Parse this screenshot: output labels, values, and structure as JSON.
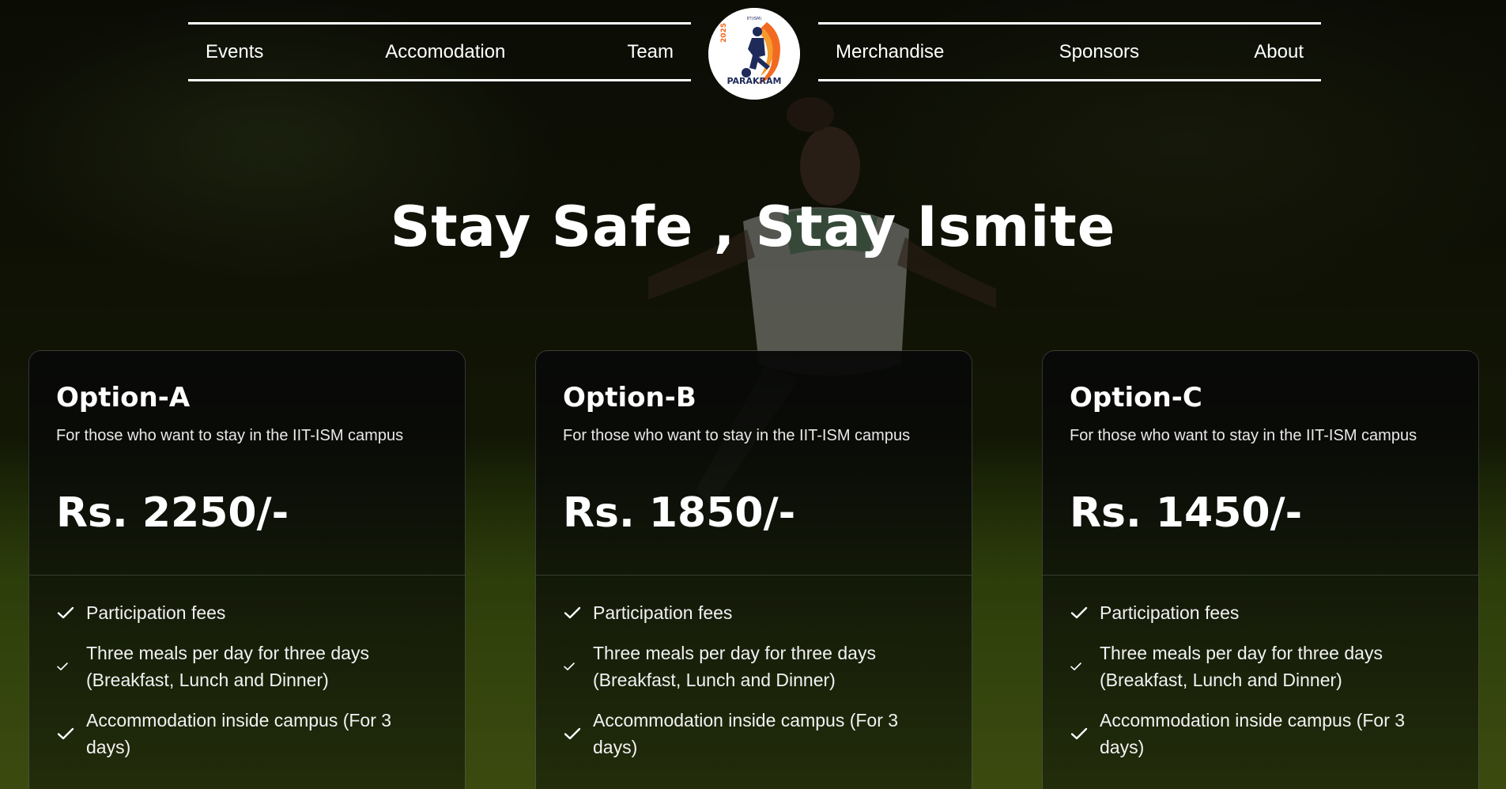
{
  "nav": {
    "left": [
      "Events",
      "Accomodation",
      "Team"
    ],
    "right": [
      "Merchandise",
      "Sponsors",
      "About"
    ]
  },
  "logo": {
    "top_text": "IIT(ISM)",
    "year": "2025",
    "name": "PARAKRAM",
    "colors": {
      "orange": "#f26a21",
      "navy": "#1d2a5a"
    }
  },
  "hero": {
    "title": "Stay Safe , Stay Ismite"
  },
  "cards": [
    {
      "name": "Option-A",
      "description": "For those who want to stay in the IIT-ISM campus",
      "price": "Rs. 2250/-",
      "features": [
        "Participation fees",
        "Three meals per day for three days (Breakfast, Lunch and Dinner)",
        "Accommodation inside campus (For 3 days)"
      ]
    },
    {
      "name": "Option-B",
      "description": "For those who want to stay in the IIT-ISM campus",
      "price": "Rs. 1850/-",
      "features": [
        "Participation fees",
        "Three meals per day for three days (Breakfast, Lunch and Dinner)",
        "Accommodation inside campus (For 3 days)"
      ]
    },
    {
      "name": "Option-C",
      "description": "For those who want to stay in the IIT-ISM campus",
      "price": "Rs. 1450/-",
      "features": [
        "Participation fees",
        "Three meals per day for three days (Breakfast, Lunch and Dinner)",
        "Accommodation inside campus (For 3 days)"
      ]
    }
  ],
  "colors": {
    "text": "#ffffff",
    "card_border": "#3a3a3a",
    "background": "#0c0d08"
  }
}
